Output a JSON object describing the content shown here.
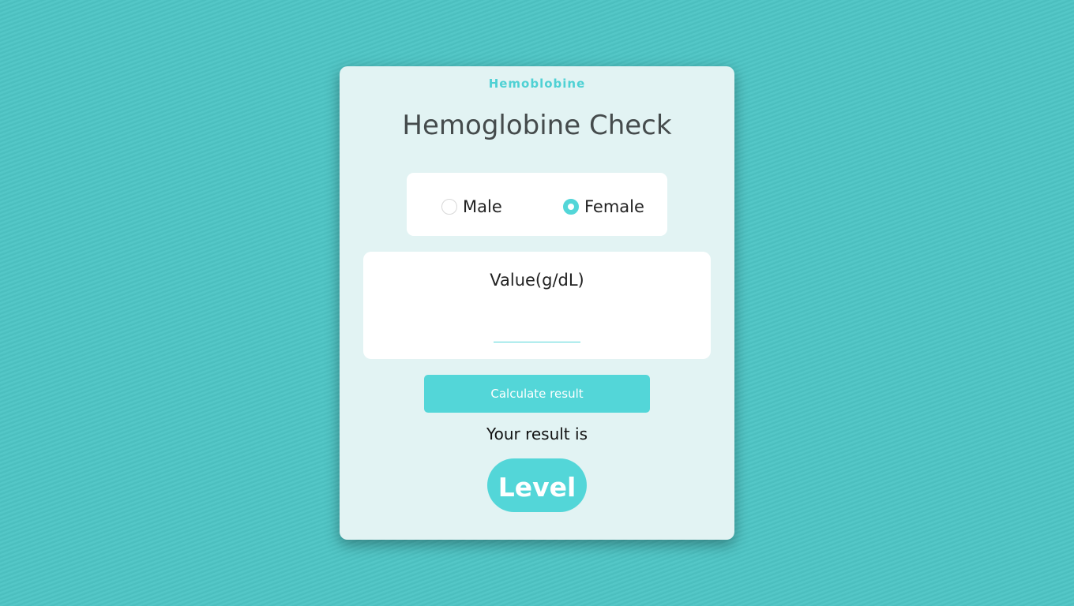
{
  "colors": {
    "background": "#4ec5c5",
    "card": "#e2f3f3",
    "accent": "#53d6d8",
    "title_text": "#454b4c"
  },
  "app": {
    "brand": "Hemoblobine",
    "title": "Hemoglobine Check"
  },
  "gender": {
    "options": [
      {
        "label": "Male",
        "selected": false
      },
      {
        "label": "Female",
        "selected": true
      }
    ]
  },
  "value_field": {
    "label": "Value(g/dL)",
    "value": "",
    "placeholder": ""
  },
  "actions": {
    "calculate_label": "Calculate result"
  },
  "result": {
    "prefix": "Your result is",
    "level": "Level"
  }
}
